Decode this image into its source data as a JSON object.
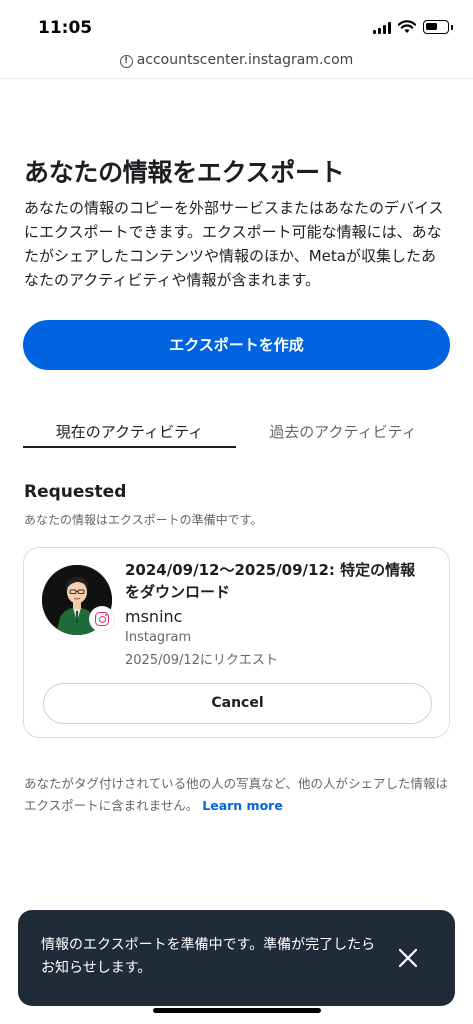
{
  "status_bar": {
    "time": "11:05"
  },
  "browser": {
    "url": "accountscenter.instagram.com"
  },
  "page": {
    "title": "あなたの情報をエクスポート",
    "description": "あなたの情報のコピーを外部サービスまたはあなたのデバイスにエクスポートできます。エクスポート可能な情報には、あなたがシェアしたコンテンツや情報のほか、Metaが収集したあなたのアクティビティや情報が含まれます。",
    "create_button_label": "エクスポートを作成"
  },
  "tabs": [
    {
      "label": "現在のアクティビティ",
      "selected": true
    },
    {
      "label": "過去のアクティビティ",
      "selected": false
    }
  ],
  "requested": {
    "heading": "Requested",
    "subtext": "あなたの情報はエクスポートの準備中です。",
    "card": {
      "title": "2024/09/12〜2025/09/12: 特定の情報をダウンロード",
      "username": "msninc",
      "platform": "Instagram",
      "request_date": "2025/09/12にリクエスト",
      "cancel_label": "Cancel",
      "badge_icon": "instagram-icon"
    }
  },
  "footer": {
    "note": "あなたがタグ付けされている他の人の写真など、他の人がシェアした情報はエクスポートに含まれません。",
    "learn_more": "Learn more"
  },
  "toast": {
    "message": "情報のエクスポートを準備中です。準備が完了したらお知らせします。",
    "close_icon": "close-icon"
  },
  "colors": {
    "primary": "#0064e0",
    "toast_bg": "#1f2c38",
    "instagram": "#e1306c"
  }
}
